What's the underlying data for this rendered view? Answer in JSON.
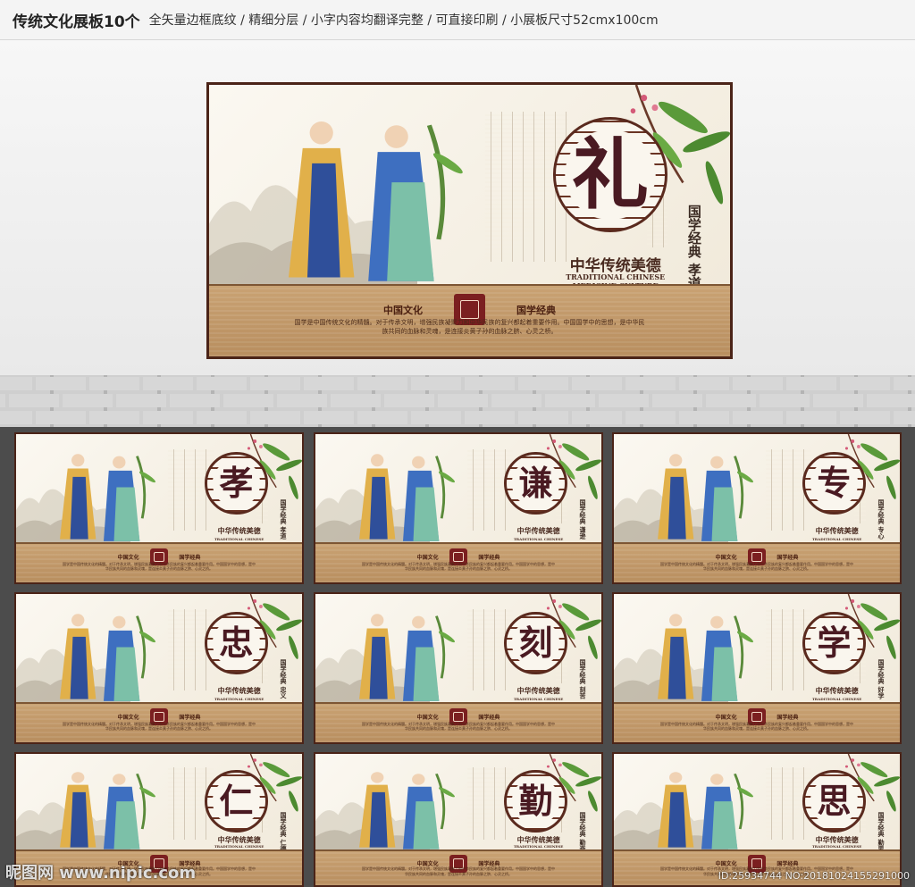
{
  "header": {
    "title": "传统文化展板10个",
    "features": "全矢量边框底纹 / 精细分层 / 小字内容均翻译完整 / 可直接印刷 / 小展板尺寸52cmx100cm"
  },
  "board_common": {
    "slogan": "中华传统美德",
    "slogan_en_line1": "TRADITIONAL CHINESE",
    "slogan_en_line2": "MEDICINE CULTURE",
    "vertical_title": "国学经典",
    "footer_head_left": "中国文化",
    "footer_head_right": "国学经典",
    "footer_body": "国学是中国传统文化的精髓。对于传承文明，增强民族凝聚力和中华民族的复兴都起着重要作用。中国国学中的思想，是中华民族共同的血脉和灵魂，是连接炎黄子孙的血脉之脐、心灵之桥。"
  },
  "main_board": {
    "character": "礼",
    "theme_word": "孝道"
  },
  "small_boards": [
    {
      "character": "孝",
      "theme_word": "孝道"
    },
    {
      "character": "谦",
      "theme_word": "谦逊"
    },
    {
      "character": "专",
      "theme_word": "专心"
    },
    {
      "character": "忠",
      "theme_word": "忠义"
    },
    {
      "character": "刻",
      "theme_word": "刻苦"
    },
    {
      "character": "学",
      "theme_word": "好学"
    },
    {
      "character": "仁",
      "theme_word": "仁德"
    },
    {
      "character": "勤",
      "theme_word": "勤奋"
    },
    {
      "character": "思",
      "theme_word": "勤思"
    }
  ],
  "watermark": {
    "left": "昵图网 www.nipic.com",
    "right": "ID:25934744 NO:20181024155291000"
  },
  "colors": {
    "frame": "#4b2418",
    "character": "#4a1a22",
    "footer": "#c9a273",
    "seal": "#7b1f20",
    "backdrop": "#4c4c4c"
  }
}
